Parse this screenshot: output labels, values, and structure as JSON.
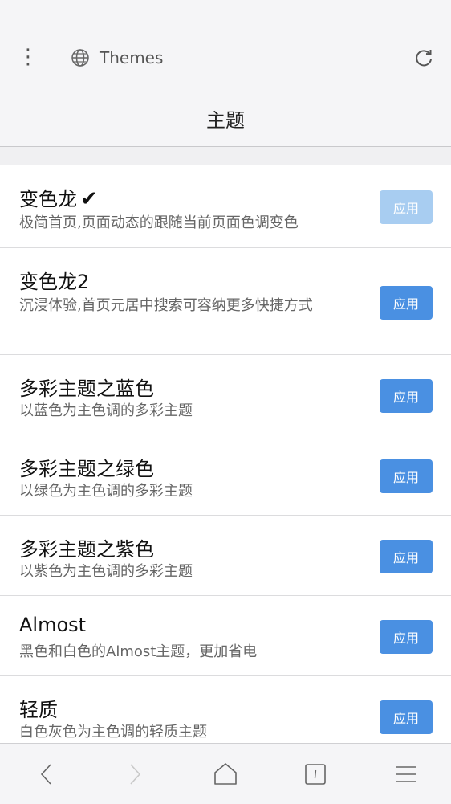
{
  "toolbar": {
    "url_text": "Themes",
    "page_title": "主题"
  },
  "themes": [
    {
      "name": "变色龙",
      "desc": "极简首页,页面动态的跟随当前页面色调变色",
      "button": "应用",
      "current": true
    },
    {
      "name": "变色龙2",
      "desc": "沉浸体验,首页元居中搜索可容纳更多快捷方式",
      "button": "应用",
      "current": false
    },
    {
      "name": "多彩主题之蓝色",
      "desc": "以蓝色为主色调的多彩主题",
      "button": "应用",
      "current": false
    },
    {
      "name": "多彩主题之绿色",
      "desc": "以绿色为主色调的多彩主题",
      "button": "应用",
      "current": false
    },
    {
      "name": "多彩主题之紫色",
      "desc": "以紫色为主色调的多彩主题",
      "button": "应用",
      "current": false
    },
    {
      "name": "Almost",
      "desc": "黑色和白色的Almost主题，更加省电",
      "button": "应用",
      "current": false
    },
    {
      "name": "轻质",
      "desc": "白色灰色为主色调的轻质主题",
      "button": "应用",
      "current": false
    }
  ],
  "colors": {
    "accent": "#4a90e2",
    "accent_disabled": "#a8cdf1"
  }
}
